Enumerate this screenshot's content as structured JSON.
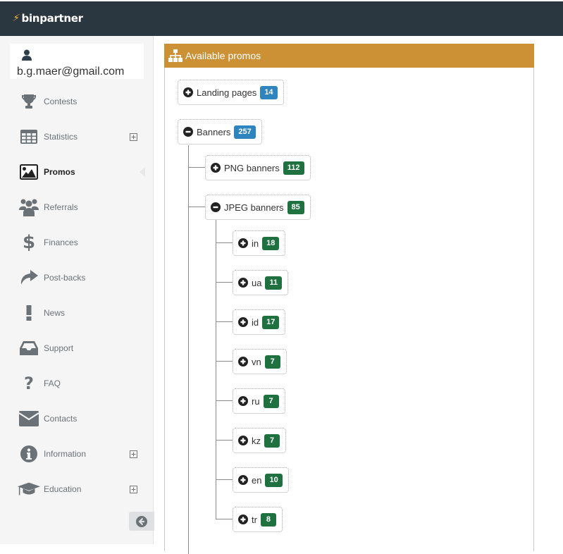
{
  "app": {
    "brand": "binpartner",
    "brand_color": "#2a3640",
    "accent_bolt_color": "#f2b233"
  },
  "user": {
    "email": "b.g.maer@gmail.com",
    "icon": "user-icon"
  },
  "sidebar": {
    "items": [
      {
        "label": "Contests",
        "icon": "trophy-icon",
        "expandable": false,
        "active": false
      },
      {
        "label": "Statistics",
        "icon": "table-icon",
        "expandable": true,
        "active": false
      },
      {
        "label": "Promos",
        "icon": "image-icon",
        "expandable": false,
        "active": true
      },
      {
        "label": "Referrals",
        "icon": "users-icon",
        "expandable": false,
        "active": false
      },
      {
        "label": "Finances",
        "icon": "dollar-icon",
        "expandable": false,
        "active": false
      },
      {
        "label": "Post-backs",
        "icon": "share-icon",
        "expandable": false,
        "active": false
      },
      {
        "label": "News",
        "icon": "exclamation-icon",
        "expandable": false,
        "active": false
      },
      {
        "label": "Support",
        "icon": "inbox-icon",
        "expandable": false,
        "active": false
      },
      {
        "label": "FAQ",
        "icon": "question-icon",
        "expandable": false,
        "active": false
      },
      {
        "label": "Contacts",
        "icon": "envelope-icon",
        "expandable": false,
        "active": false
      },
      {
        "label": "Information",
        "icon": "info-icon",
        "expandable": true,
        "active": false
      },
      {
        "label": "Education",
        "icon": "graduation-cap-icon",
        "expandable": true,
        "active": false
      }
    ],
    "collapse_icon": "arrow-circle-left-icon"
  },
  "panel": {
    "title": "Available promos",
    "header_color": "#cc9035",
    "icon": "sitemap-icon"
  },
  "tree": {
    "landing_pages": {
      "label": "Landing pages",
      "count": "14",
      "state": "collapsed"
    },
    "banners": {
      "label": "Banners",
      "count": "257",
      "state": "expanded"
    },
    "png_banners": {
      "label": "PNG banners",
      "count": "112",
      "state": "collapsed"
    },
    "jpeg_banners": {
      "label": "JPEG banners",
      "count": "85",
      "state": "expanded"
    },
    "languages": [
      {
        "label": "in",
        "count": "18"
      },
      {
        "label": "ua",
        "count": "11"
      },
      {
        "label": "id",
        "count": "17"
      },
      {
        "label": "vn",
        "count": "7"
      },
      {
        "label": "ru",
        "count": "7"
      },
      {
        "label": "kz",
        "count": "7"
      },
      {
        "label": "en",
        "count": "10"
      },
      {
        "label": "tr",
        "count": "8"
      }
    ],
    "badge_colors": {
      "top_level": "#2d84bf",
      "nested": "#1f7140"
    }
  }
}
